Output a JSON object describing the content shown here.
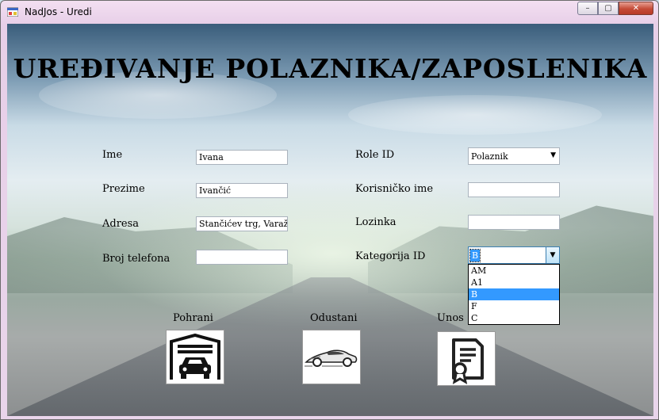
{
  "window": {
    "title": "NadJos - Uredi"
  },
  "caption": {
    "minimize": "–",
    "maximize": "▢",
    "close": "✕"
  },
  "page": {
    "title": "UREĐIVANJE POLAZNIKA/ZAPOSLENIKA"
  },
  "form": {
    "ime": {
      "label": "Ime",
      "value": "Ivana"
    },
    "prezime": {
      "label": "Prezime",
      "value": "Ivančić"
    },
    "adresa": {
      "label": "Adresa",
      "value": "Stančićev trg, Varaž"
    },
    "telefon": {
      "label": "Broj telefona",
      "value": ""
    },
    "role": {
      "label": "Role ID",
      "value": "Polaznik"
    },
    "korisnicko": {
      "label": "Korisničko ime",
      "value": ""
    },
    "lozinka": {
      "label": "Lozinka",
      "value": ""
    },
    "kategorija": {
      "label": "Kategorija ID",
      "value": "B",
      "options": [
        "AM",
        "A1",
        "B",
        "F",
        "C"
      ],
      "selected_index": 2
    }
  },
  "actions": {
    "pohrani": {
      "label": "Pohrani",
      "icon": "garage-car-icon"
    },
    "odustani": {
      "label": "Odustani",
      "icon": "sports-car-icon"
    },
    "unos": {
      "label": "Unos",
      "icon": "certificate-document-icon"
    }
  },
  "colors": {
    "selection": "#3399ff",
    "close_button": "#c54a36"
  }
}
